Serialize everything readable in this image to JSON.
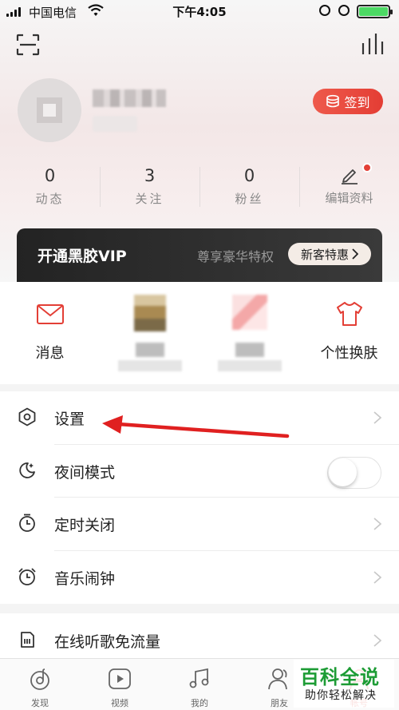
{
  "status_bar": {
    "carrier": "中国电信",
    "time": "下午4:05"
  },
  "profile": {
    "checkin_label": "签到"
  },
  "stats": [
    {
      "value": "0",
      "label": "动态"
    },
    {
      "value": "3",
      "label": "关注"
    },
    {
      "value": "0",
      "label": "粉丝"
    },
    {
      "label": "编辑资料"
    }
  ],
  "vip": {
    "title": "开通黑胶VIP",
    "desc": "尊享豪华特权",
    "badge": "新客特惠"
  },
  "quick_actions": [
    {
      "label": "消息"
    },
    {
      "label": ""
    },
    {
      "label": ""
    },
    {
      "label": "个性换肤"
    }
  ],
  "menu": [
    {
      "label": "设置",
      "icon": "settings-hexagon-icon",
      "control": "chevron"
    },
    {
      "label": "夜间模式",
      "icon": "moon-icon",
      "control": "toggle",
      "toggle_on": false
    },
    {
      "label": "定时关闭",
      "icon": "timer-icon",
      "control": "chevron"
    },
    {
      "label": "音乐闹钟",
      "icon": "alarm-icon",
      "control": "chevron"
    }
  ],
  "menu2": [
    {
      "label": "在线听歌免流量",
      "icon": "sim-card-icon",
      "control": "chevron"
    }
  ],
  "tabbar": [
    {
      "label": "发现",
      "icon": "netease-logo-icon"
    },
    {
      "label": "视频",
      "icon": "play-icon"
    },
    {
      "label": "我的",
      "icon": "music-note-icon"
    },
    {
      "label": "朋友",
      "icon": "friends-icon"
    },
    {
      "label": "帐号",
      "icon": "account-icon",
      "active": true
    }
  ],
  "watermark": {
    "title": "百科全说",
    "subtitle": "助你轻松解决"
  },
  "colors": {
    "accent": "#e33f36",
    "watermark_green": "#1d9c35",
    "annotation_arrow": "#e02020"
  }
}
